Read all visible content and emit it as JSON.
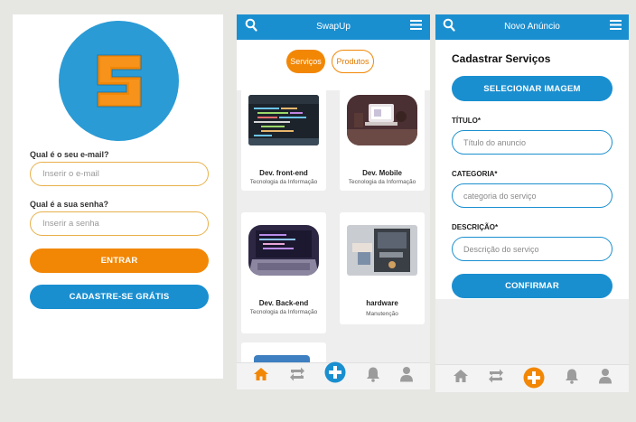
{
  "colors": {
    "blue": "#1a8fd0",
    "orange": "#f28705",
    "field_border_orange": "#e8b04a"
  },
  "login": {
    "email_label": "Qual é o seu e-mail?",
    "email_placeholder": "Inserir o e-mail",
    "password_label": "Qual é a sua senha?",
    "password_placeholder": "Inserir a senha",
    "enter_button": "ENTRAR",
    "signup_button": "CADASTRE-SE GRÁTIS"
  },
  "feed": {
    "title": "SwapUp",
    "tabs": [
      {
        "label": "Serviços",
        "active": true
      },
      {
        "label": "Produtos",
        "active": false
      }
    ],
    "cards": [
      {
        "title": "Dev. front-end",
        "subtitle": "Tecnologia da Informação"
      },
      {
        "title": "Dev. Mobile",
        "subtitle": "Tecnologia da Informação"
      },
      {
        "title": "Dev. Back-end",
        "subtitle": "Tecnologia da Informação"
      },
      {
        "title": "hardware",
        "subtitle": "Manutenção"
      }
    ]
  },
  "new_ad": {
    "title": "Novo Anúncio",
    "heading": "Cadastrar Serviços",
    "select_image_button": "SELECIONAR IMAGEM",
    "title_label": "TÍTULO*",
    "title_placeholder": "Título do anuncio",
    "category_label": "CATEGORIA*",
    "category_placeholder": "categoria do serviço",
    "description_label": "DESCRIÇÃO*",
    "description_placeholder": "Descrição do serviço",
    "confirm_button": "CONFIRMAR"
  },
  "icons": [
    "search-icon",
    "menu-icon",
    "home-icon",
    "swap-icon",
    "add-icon",
    "bell-icon",
    "user-icon"
  ]
}
